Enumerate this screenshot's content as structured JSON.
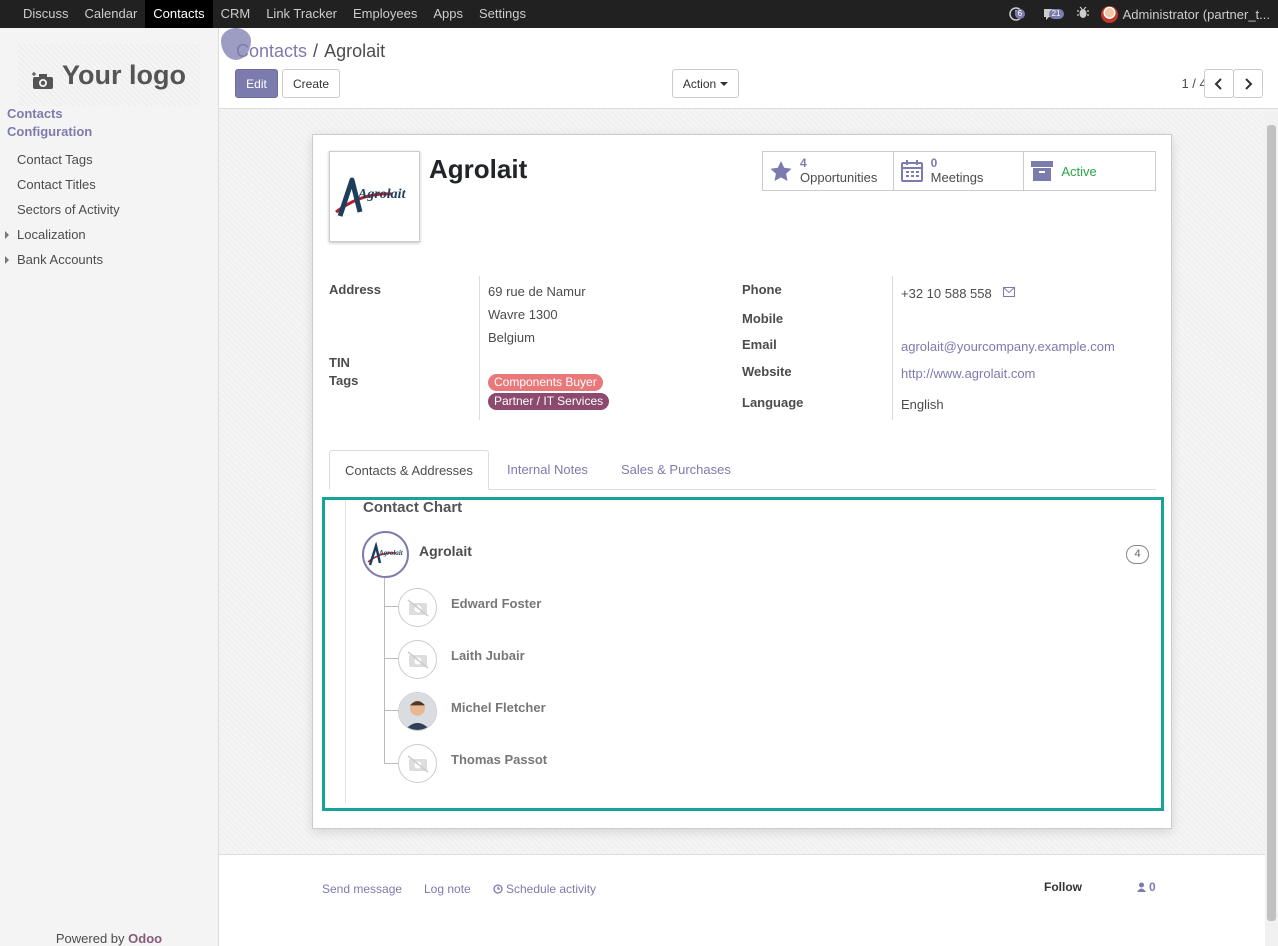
{
  "topbar": {
    "apps": [
      "Discuss",
      "Calendar",
      "Contacts",
      "CRM",
      "Link Tracker",
      "Employees",
      "Apps",
      "Settings"
    ],
    "active_app": "Contacts",
    "activity_count": "6",
    "message_count": "21",
    "user_label": "Administrator (partner_t..."
  },
  "sidebar": {
    "logo_text": "Your logo",
    "heading_contacts": "Contacts",
    "heading_config": "Configuration",
    "items": [
      "Contact Tags",
      "Contact Titles",
      "Sectors of Activity",
      "Localization",
      "Bank Accounts"
    ],
    "powered_prefix": "Powered by ",
    "powered_brand": "Odoo"
  },
  "control": {
    "breadcrumb_parent": "Contacts",
    "breadcrumb_sep": "/",
    "breadcrumb_current": "Agrolait",
    "edit_label": "Edit",
    "create_label": "Create",
    "action_label": "Action",
    "pager": "1 / 40"
  },
  "record": {
    "name": "Agrolait",
    "logo_text": "Agrolait",
    "smart_buttons": [
      {
        "num": "4",
        "label": "Opportunities",
        "icon": "star-icon"
      },
      {
        "num": "0",
        "label": "Meetings",
        "icon": "calendar-icon"
      },
      {
        "num": "",
        "label": "Active",
        "icon": "archive-icon"
      }
    ],
    "labels": {
      "address": "Address",
      "tin": "TIN",
      "tags": "Tags",
      "phone": "Phone",
      "mobile": "Mobile",
      "email": "Email",
      "website": "Website",
      "language": "Language"
    },
    "address_lines": [
      "69 rue de Namur",
      "Wavre 1300",
      "Belgium"
    ],
    "tags": [
      {
        "label": "Components Buyer",
        "color": "#e9787a"
      },
      {
        "label": "Partner / IT Services",
        "color": "#8b4a6e"
      }
    ],
    "phone": "+32 10 588 558",
    "email": "agrolait@yourcompany.example.com",
    "website": "http://www.agrolait.com",
    "language": "English"
  },
  "tabs": [
    "Contacts & Addresses",
    "Internal Notes",
    "Sales & Purchases"
  ],
  "contact_chart": {
    "title": "Contact Chart",
    "root": "Agrolait",
    "count": "4",
    "children": [
      "Edward Foster",
      "Laith Jubair",
      "Michel Fletcher",
      "Thomas Passot"
    ]
  },
  "chatter": {
    "send_message": "Send message",
    "log_note": "Log note",
    "schedule_activity": "Schedule activity",
    "follow": "Follow",
    "followers": "0"
  },
  "colors": {
    "accent": "#7c7bad",
    "highlight_frame": "#17a398",
    "active_status": "#28a745"
  }
}
